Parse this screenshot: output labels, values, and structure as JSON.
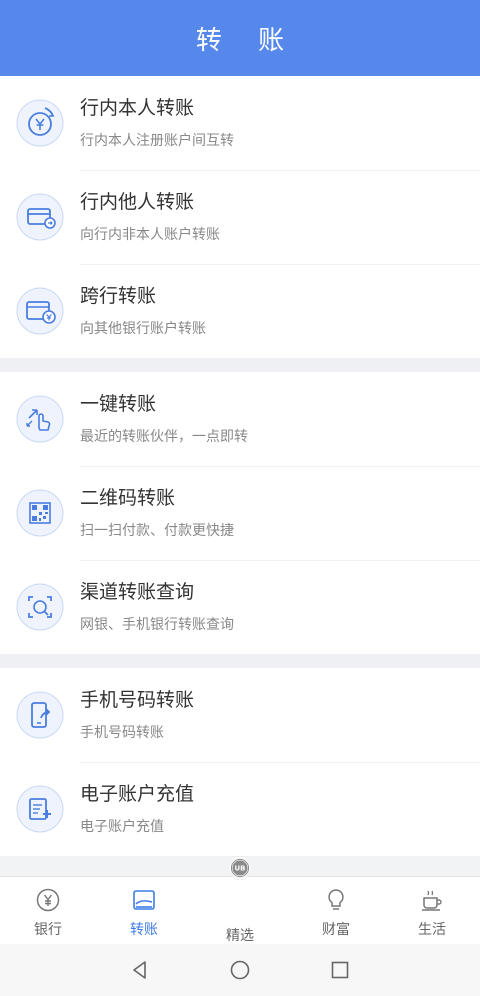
{
  "header": {
    "title": "转 账"
  },
  "groups": [
    [
      {
        "title": "行内本人转账",
        "subtitle": "行内本人注册账户间互转",
        "icon": "yuan-circle-icon"
      },
      {
        "title": "行内他人转账",
        "subtitle": "向行内非本人账户转账",
        "icon": "card-transfer-icon"
      },
      {
        "title": "跨行转账",
        "subtitle": "向其他银行账户转账",
        "icon": "wallet-yuan-icon"
      }
    ],
    [
      {
        "title": "一键转账",
        "subtitle": "最近的转账伙伴，一点即转",
        "icon": "tap-hand-icon"
      },
      {
        "title": "二维码转账",
        "subtitle": "扫一扫付款、付款更快捷",
        "icon": "qr-code-icon"
      },
      {
        "title": "渠道转账查询",
        "subtitle": "网银、手机银行转账查询",
        "icon": "scan-query-icon"
      }
    ],
    [
      {
        "title": "手机号码转账",
        "subtitle": "手机号码转账",
        "icon": "phone-share-icon"
      },
      {
        "title": "电子账户充值",
        "subtitle": "电子账户充值",
        "icon": "document-plus-icon"
      }
    ]
  ],
  "tabbar": {
    "tabs": [
      {
        "label": "银行",
        "icon": "yuan-coin-icon"
      },
      {
        "label": "转账",
        "icon": "transfer-card-icon"
      },
      {
        "label": "精选",
        "icon": "ub-badge-icon"
      },
      {
        "label": "财富",
        "icon": "lightbulb-icon"
      },
      {
        "label": "生活",
        "icon": "coffee-cup-icon"
      }
    ],
    "center_badge_text": "UB",
    "active_tab": "转账"
  },
  "colors": {
    "accent": "#5588ea",
    "active_tab": "#3d7be6",
    "icon_stroke": "#4a7ddf"
  }
}
